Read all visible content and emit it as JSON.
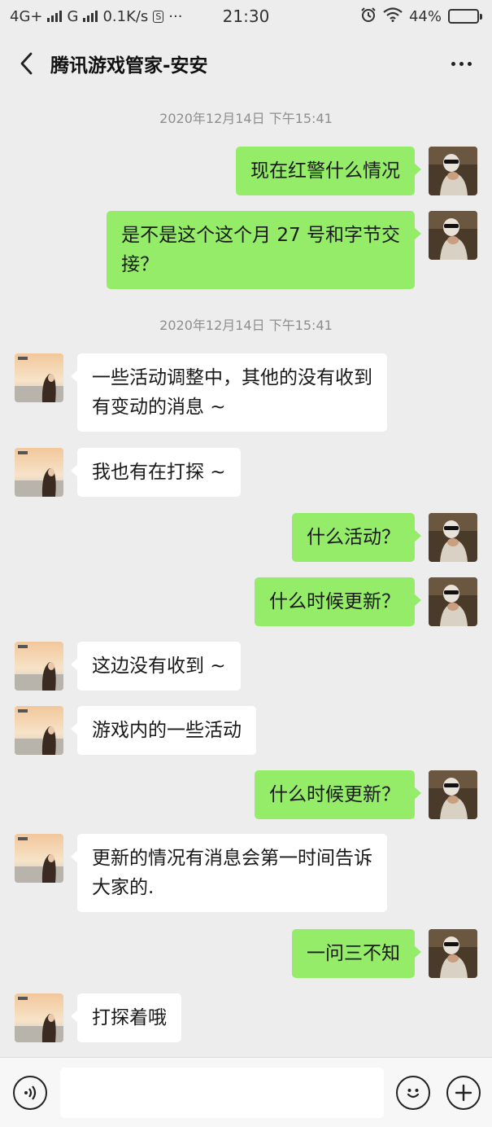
{
  "status_bar": {
    "network_left": "4G+",
    "network_right": "G",
    "speed": "0.1K/s",
    "s_badge": "S",
    "more": "···",
    "time": "21:30",
    "battery_text": "44%",
    "battery_level": 0.44
  },
  "header": {
    "title": "腾讯游戏管家-安安"
  },
  "messages": {
    "ts1": "2020年12月14日 下午15:41",
    "m1": "现在红警什么情况",
    "m2": "是不是这个这个月 27 号和字节交\n接？",
    "ts2": "2020年12月14日 下午15:41",
    "m3": "一些活动调整中，其他的没有收到\n有变动的消息 ~",
    "m4": "我也有在打探 ~",
    "m5": "什么活动？",
    "m6": "什么时候更新？",
    "m7": "这边没有收到 ~",
    "m8": "游戏内的一些活动",
    "m9": "什么时候更新？",
    "m10": "更新的情况有消息会第一时间告诉\n大家的.",
    "m11": "一问三不知",
    "m12": "打探着哦"
  },
  "input": {
    "value": "",
    "placeholder": ""
  },
  "icons": {
    "back": "chevron-left-icon",
    "more": "more-dots-icon",
    "voice": "voice-icon",
    "emoji": "emoji-icon",
    "plus": "plus-icon",
    "alarm": "alarm-icon",
    "wifi": "wifi-icon"
  },
  "colors": {
    "outgoing_bubble": "#95ec69",
    "incoming_bubble": "#ffffff",
    "background": "#ededed"
  }
}
